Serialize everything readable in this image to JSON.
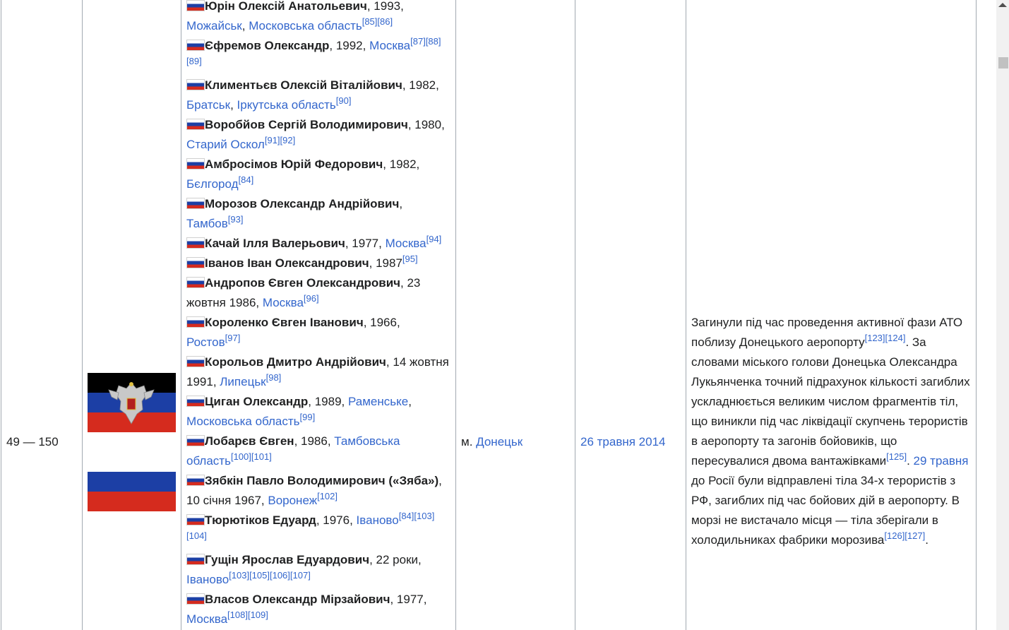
{
  "row": {
    "number": "49 — 150",
    "city_prefix": "м. ",
    "city_link": "Донецьк",
    "date": "26 травня 2014"
  },
  "persons": [
    {
      "name": "Юрін Олексій Анатольевич",
      "rest": ", 1993, ",
      "links": [
        {
          "t": "Можайськ"
        },
        {
          "s": ", "
        },
        {
          "t": "Московська область"
        }
      ],
      "refs": "[85][86]"
    },
    {
      "name": "Єфремов Олександр",
      "rest": ", 1992, ",
      "links": [
        {
          "t": "Москва"
        }
      ],
      "refs": "[87][88][89]"
    },
    {
      "name": "Климентьєв Олексій Віталійович",
      "rest": ", 1982, ",
      "links": [
        {
          "t": "Братськ"
        },
        {
          "s": ", "
        },
        {
          "t": "Іркутська область"
        }
      ],
      "refs": "[90]"
    },
    {
      "name": "Воробйов Сергій Володимирович",
      "rest": ", 1980, ",
      "links": [
        {
          "t": "Старий Оскол"
        }
      ],
      "refs": "[91][92]"
    },
    {
      "name": "Амбросімов Юрій Федорович",
      "rest": ", 1982, ",
      "links": [
        {
          "t": "Бєлгород"
        }
      ],
      "refs": "[84]"
    },
    {
      "name": "Морозов Олександр Андрійович",
      "rest": ", ",
      "links": [
        {
          "t": "Тамбов"
        }
      ],
      "refs": "[93]"
    },
    {
      "name": "Качай Ілля Валерьович",
      "rest": ", 1977, ",
      "links": [
        {
          "t": "Москва"
        }
      ],
      "refs": "[94]"
    },
    {
      "name": "Іванов Іван Олександрович",
      "rest": ", 1987",
      "links": [],
      "refs": "[95]"
    },
    {
      "name": "Андропов Євген Олександрович",
      "rest": ", 23 жовтня 1986, ",
      "links": [
        {
          "t": "Москва"
        }
      ],
      "refs": "[96]"
    },
    {
      "name": "Короленко Євген Іванович",
      "rest": ", 1966, ",
      "links": [
        {
          "t": "Ростов"
        }
      ],
      "refs": "[97]"
    },
    {
      "name": "Корольов Дмитро Андрійович",
      "rest": ", 14 жовтня 1991, ",
      "links": [
        {
          "t": "Липецьк"
        }
      ],
      "refs": "[98]"
    },
    {
      "name": "Циган Олександр",
      "rest": ", 1989, ",
      "links": [
        {
          "t": "Раменське"
        },
        {
          "s": ", "
        },
        {
          "t": "Московська область"
        }
      ],
      "refs": "[99]"
    },
    {
      "name": "Лобарєв Євген",
      "rest": ", 1986, ",
      "links": [
        {
          "t": "Тамбовська область"
        }
      ],
      "refs": "[100][101]"
    },
    {
      "name": "Зябкін Павло Володимирович («Зяба»)",
      "rest": ", 10 січня 1967, ",
      "links": [
        {
          "t": "Воронеж"
        }
      ],
      "refs": "[102]"
    },
    {
      "name": "Тюрютіков Едуард",
      "rest": ", 1976, ",
      "links": [
        {
          "t": "Іваново"
        }
      ],
      "refs": "[84][103][104]"
    },
    {
      "name": "Гущін Ярослав Едуардович",
      "rest": ", 22 роки, ",
      "links": [
        {
          "t": "Іваново"
        }
      ],
      "refs": "[103][105][106][107]"
    },
    {
      "name": "Власов Олександр Мірзайович",
      "rest": ", 1977, ",
      "links": [
        {
          "t": "Москва"
        }
      ],
      "refs": "[108][109]"
    }
  ],
  "notes": {
    "p1": "Загинули під час проведення активної фази АТО поблизу Донецького аеропорту",
    "r1": "[123][124]",
    "p2": ". За словами міського голови Донецька Олександра Лукьянченка точний підрахунок кількості загиблих ускладнюється великим числом фрагментів тіл, що виникли під час ліквідації скупчень терористів в аеропорту та загонів бойовиків, що пересувалися двома вантажівками",
    "r2": "[125]",
    "p3": ". ",
    "link": "29 травня",
    "p4": " до Росії були відправлені тіла 34-х терористів з РФ, загиблих під час бойових дій в аеропорту. В морзі не вистачало місця — тіла зберігали в холодильниках фабрики морозива",
    "r3": "[126][127]",
    "p5": "."
  },
  "flags": [
    "dnr-flag",
    "russia-flag"
  ],
  "colors": {
    "link": "#3366cc",
    "border": "#a2a9b1",
    "ru_white": "#ffffff",
    "ru_blue": "#1c3fa5",
    "ru_red": "#d52b1e",
    "dnr_black": "#000000",
    "dnr_blue": "#1c3fa5",
    "dnr_red": "#d52b1e"
  }
}
